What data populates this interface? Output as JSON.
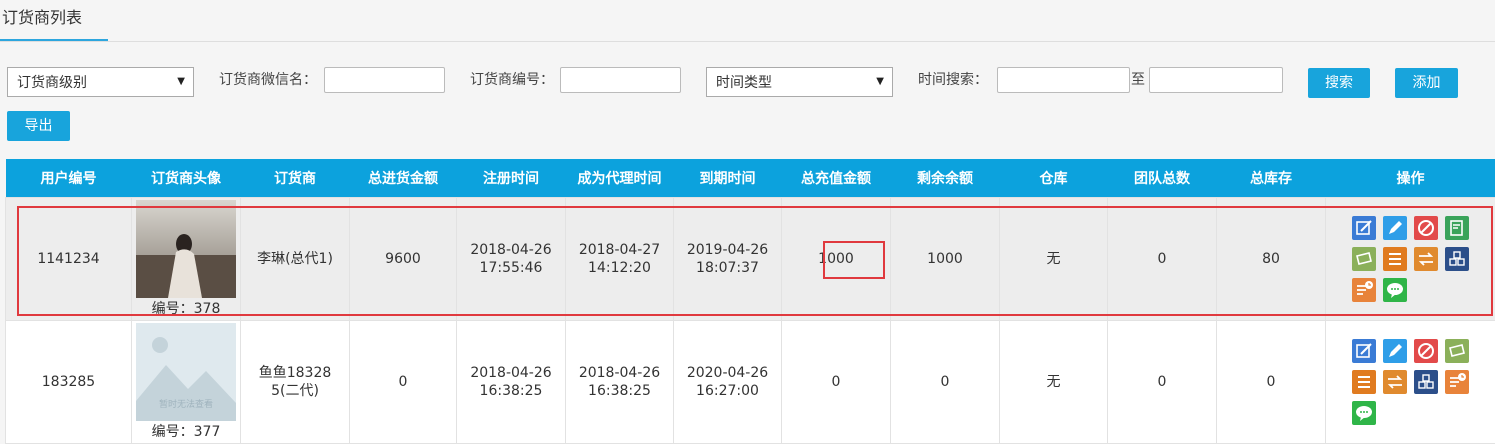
{
  "tab": {
    "title": "订货商列表"
  },
  "filters": {
    "level_select": "订货商级别",
    "wechat_label": "订货商微信名：",
    "number_label": "订货商编号：",
    "time_type_select": "时间类型",
    "time_search_label": "时间搜索：",
    "to_label": "至",
    "search_button": "搜索",
    "add_button": "添加",
    "export_button": "导出"
  },
  "table": {
    "headers": [
      "用户编号",
      "订货商头像",
      "订货商",
      "总进货金额",
      "注册时间",
      "成为代理时间",
      "到期时间",
      "总充值金额",
      "剩余余额",
      "仓库",
      "团队总数",
      "总库存",
      "操作"
    ],
    "rows": [
      {
        "user_id": "1141234",
        "avatar_caption": "编号：378",
        "name": "李琳(总代1)",
        "total_purchase": "9600",
        "register_date": "2018-04-26",
        "register_time": "17:55:46",
        "agent_date": "2018-04-27",
        "agent_time": "14:12:20",
        "expire_date": "2019-04-26",
        "expire_time": "18:07:37",
        "total_recharge": "1000",
        "balance": "1000",
        "warehouse": "无",
        "team_total": "0",
        "total_stock": "80"
      },
      {
        "user_id": "183285",
        "avatar_caption": "编号：377",
        "avatar_placeholder": "暂时无法查看",
        "name": "鱼鱼183285(二代)",
        "total_purchase": "0",
        "register_date": "2018-04-26",
        "register_time": "16:38:25",
        "agent_date": "2018-04-26",
        "agent_time": "16:38:25",
        "expire_date": "2020-04-26",
        "expire_time": "16:27:00",
        "total_recharge": "0",
        "balance": "0",
        "warehouse": "无",
        "team_total": "0",
        "total_stock": "0"
      }
    ],
    "row1_action_icons": [
      "edit-icon",
      "pencil-icon",
      "disable-icon",
      "record-icon",
      "money-icon",
      "list-icon",
      "transfer-icon",
      "stock-icon",
      "clock-doc-icon",
      "message-icon"
    ],
    "row2_action_icons": [
      "edit-icon",
      "pencil-icon",
      "disable-icon",
      "money-icon",
      "list-icon",
      "transfer-icon",
      "stock-icon",
      "clock-doc-icon",
      "message-icon"
    ]
  },
  "colors": {
    "accent": "#18a4dc",
    "header_bg": "#0ca2dd",
    "highlight": "#e0393e",
    "link": "#2a97d6"
  }
}
